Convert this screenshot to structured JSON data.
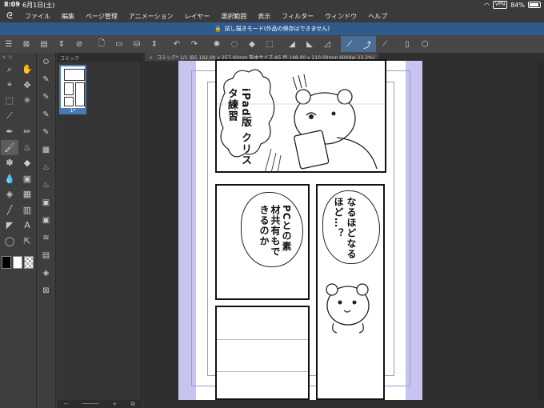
{
  "status": {
    "time": "8:09",
    "date": "6月1日(土)",
    "vpn": "VPN",
    "battery": "84%"
  },
  "menu": [
    "ファイル",
    "編集",
    "ページ管理",
    "アニメーション",
    "レイヤー",
    "選択範囲",
    "表示",
    "フィルター",
    "ウィンドウ",
    "ヘルプ"
  ],
  "banner": "試し描きモード(作品の保存はできません)",
  "pages_panel": {
    "header": "コミック",
    "thumb_label": "1*"
  },
  "document": {
    "tab_title": "コミック* 1/1 (B5 182.00 x 257.00mm 製本サイズ:A5 判 148.00 x 210.00mm 600dpi 23.2%)"
  },
  "manga": {
    "panel1_text": "iPad版 クリスタ練習",
    "panel2_bubble": "PCとの素材共有もできるのか",
    "panel3_bubble": "なるほどなるほど…？"
  }
}
